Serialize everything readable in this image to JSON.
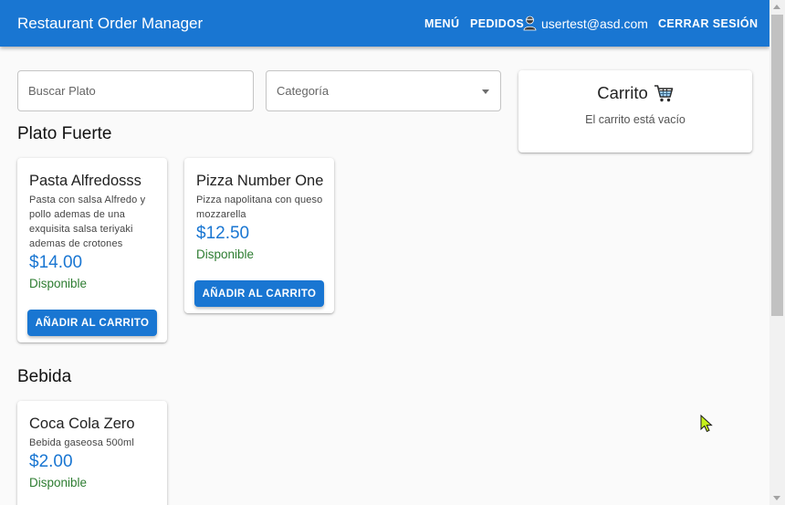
{
  "header": {
    "app_title": "Restaurant Order Manager",
    "nav_menu": "MENÚ",
    "nav_orders": "PEDIDOS",
    "user_email": "usertest@asd.com",
    "logout": "CERRAR SESIÓN"
  },
  "filters": {
    "search_placeholder": "Buscar Plato",
    "category_label": "Categoría"
  },
  "sections": [
    {
      "title": "Plato Fuerte",
      "items": [
        {
          "name": "Pasta Alfredosss",
          "description": "Pasta con salsa Alfredo y pollo ademas de una exquisita salsa teriyaki ademas de crotones",
          "price": "$14.00",
          "status": "Disponible",
          "button": "AÑADIR AL CARRITO"
        },
        {
          "name": "Pizza Number One",
          "description": "Pizza napolitana con queso mozzarella",
          "price": "$12.50",
          "status": "Disponible",
          "button": "AÑADIR AL CARRITO"
        }
      ]
    },
    {
      "title": "Bebida",
      "items": [
        {
          "name": "Coca Cola Zero",
          "description": "Bebida gaseosa 500ml",
          "price": "$2.00",
          "status": "Disponible"
        }
      ]
    }
  ],
  "cart": {
    "title": "Carrito",
    "empty_message": "El carrito está vacío",
    "icon": "shopping-cart-icon"
  },
  "colors": {
    "primary": "#1976d2",
    "available": "#2e7d32"
  }
}
